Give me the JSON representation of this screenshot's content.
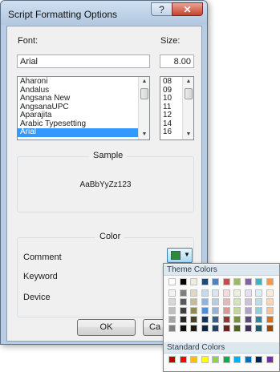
{
  "dialog": {
    "title": "Script Formatting Options",
    "help_glyph": "?",
    "close_glyph": "✕"
  },
  "font": {
    "label": "Font:",
    "value": "Arial",
    "items": [
      "Aharoni",
      "Andalus",
      "Angsana New",
      "AngsanaUPC",
      "Aparajita",
      "Arabic Typesetting",
      "Arial"
    ],
    "selected": "Arial"
  },
  "size": {
    "label": "Size:",
    "value": "8.00",
    "items": [
      "08",
      "09",
      "10",
      "11",
      "12",
      "14",
      "16"
    ]
  },
  "sample": {
    "label": "Sample",
    "text": "AaBbYyZz123"
  },
  "color": {
    "label": "Color",
    "rows": [
      "Comment",
      "Keyword",
      "Device"
    ],
    "comment_color": "#2e8b3a"
  },
  "buttons": {
    "ok": "OK",
    "cancel": "Ca"
  },
  "palette": {
    "theme_label": "Theme Colors",
    "standard_label": "Standard Colors",
    "theme_top": [
      "#ffffff",
      "#000000",
      "#eeece1",
      "#1f497d",
      "#4f81bd",
      "#c0504d",
      "#9bbb59",
      "#8064a2",
      "#4bacc6",
      "#f79646"
    ],
    "theme_shades": [
      [
        "#f2f2f2",
        "#d8d8d8",
        "#bfbfbf",
        "#a5a5a5",
        "#7f7f7f"
      ],
      [
        "#7f7f7f",
        "#595959",
        "#3f3f3f",
        "#262626",
        "#0c0c0c"
      ],
      [
        "#ddd9c3",
        "#c4bd97",
        "#938953",
        "#494429",
        "#1d1b10"
      ],
      [
        "#c6d9f0",
        "#8db3e2",
        "#548dd4",
        "#17365d",
        "#0f243e"
      ],
      [
        "#dbe5f1",
        "#b8cce4",
        "#95b3d7",
        "#366092",
        "#244061"
      ],
      [
        "#f2dcdb",
        "#e5b9b7",
        "#d99694",
        "#953734",
        "#632423"
      ],
      [
        "#ebf1dd",
        "#d7e3bc",
        "#c3d69b",
        "#76923c",
        "#4f6128"
      ],
      [
        "#e5e0ec",
        "#ccc1d9",
        "#b2a2c7",
        "#5f497a",
        "#3f3151"
      ],
      [
        "#dbeef3",
        "#b7dde8",
        "#92cddc",
        "#31859b",
        "#205867"
      ],
      [
        "#fdeada",
        "#fbd5b5",
        "#fac08f",
        "#e36c09",
        "#974806"
      ]
    ],
    "standard": [
      "#c00000",
      "#ff0000",
      "#ffc000",
      "#ffff00",
      "#92d050",
      "#00b050",
      "#00b0f0",
      "#0070c0",
      "#002060",
      "#7030a0"
    ]
  }
}
